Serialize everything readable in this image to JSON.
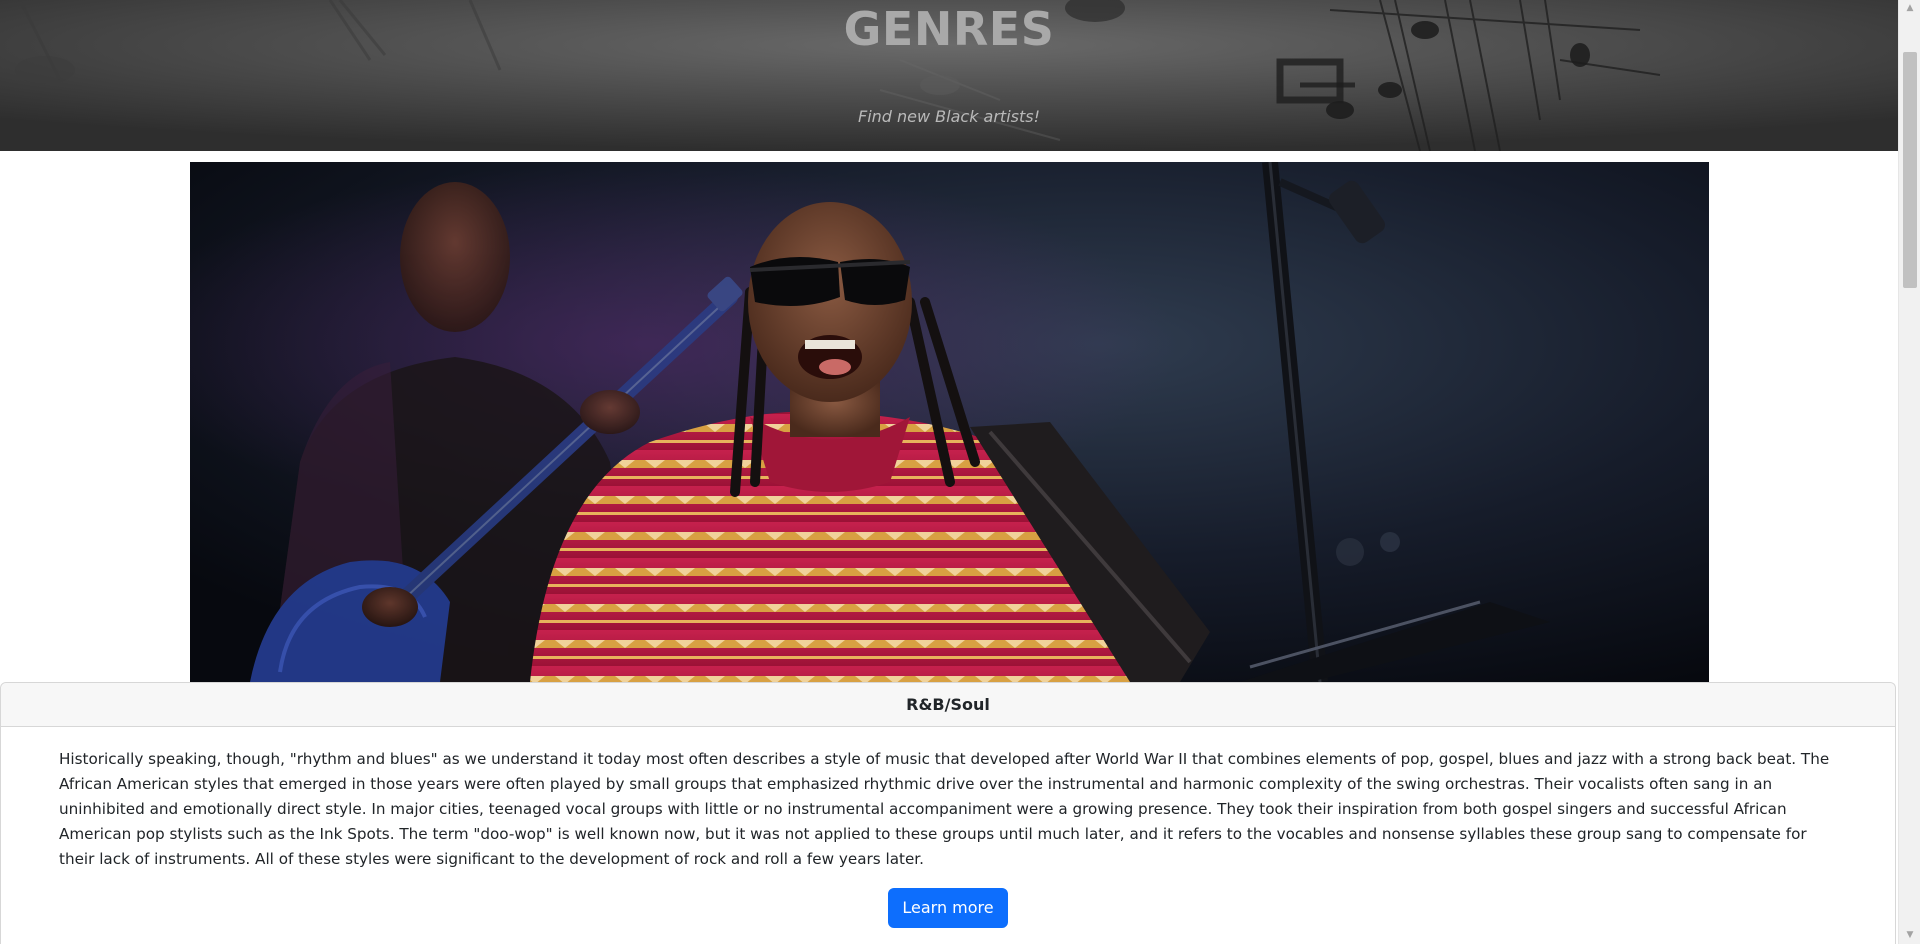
{
  "banner": {
    "title": "GENRES",
    "subtitle": "Find new Black artists!"
  },
  "hero": {
    "image_alt": "Musician in sunglasses and red patterned shirt singing on stage with a guitarist behind"
  },
  "genre_card": {
    "header": "R&B/Soul",
    "description": "Historically speaking, though, \"rhythm and blues\" as we understand it today most often describes a style of music that developed after World War II that combines elements of pop, gospel, blues and jazz with a strong back beat. The African American styles that emerged in those years were often played by small groups that emphasized rhythmic drive over the instrumental and harmonic complexity of the swing orchestras. Their vocalists often sang in an uninhibited and emotionally direct style. In major cities, teenaged vocal groups with little or no instrumental accompaniment were a growing presence. They took their inspiration from both gospel singers and successful African American pop stylists such as the Ink Spots. The term \"doo-wop\" is well known now, but it was not applied to these groups until much later, and it refers to the vocables and nonsense syllables these group sang to compensate for their lack of instruments. All of these styles were significant to the development of rock and roll a few years later.",
    "button_label": "Learn more"
  },
  "scrollbar": {
    "up_icon": "scroll-up-arrow",
    "down_icon": "scroll-down-arrow"
  },
  "colors": {
    "button": "#0d6efd",
    "card_header_bg": "#f7f7f7",
    "banner_title": "#a9a9a9"
  }
}
